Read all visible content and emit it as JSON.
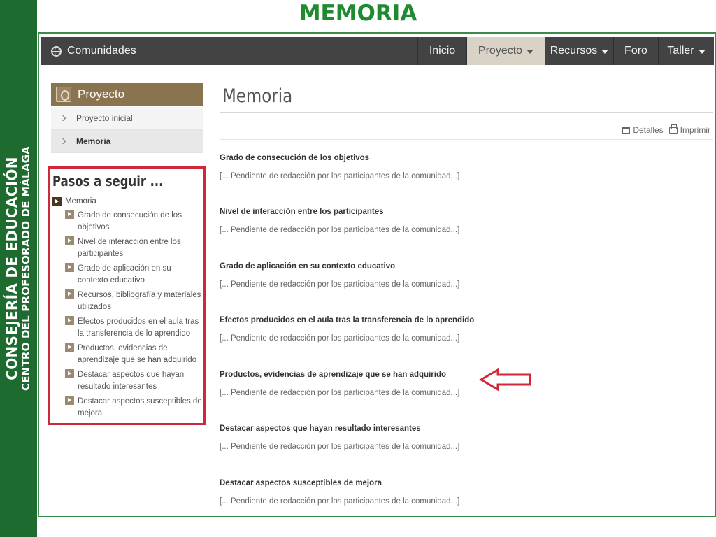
{
  "slide": {
    "title": "MEMORIA",
    "banner_line1": "CONSEJERÍA DE EDUCACIÓN",
    "banner_line2": "CENTRO DEL PROFESORADO DE MÁLAGA"
  },
  "topbar": {
    "brand": "Comunidades",
    "brand_icon": "globe-icon",
    "nav": [
      {
        "label": "Inicio",
        "dropdown": false,
        "active": false
      },
      {
        "label": "Proyecto",
        "dropdown": true,
        "active": true
      },
      {
        "label": "Recursos",
        "dropdown": true,
        "active": false
      },
      {
        "label": "Foro",
        "dropdown": false,
        "active": false
      },
      {
        "label": "Taller",
        "dropdown": true,
        "active": false
      }
    ]
  },
  "sidebar": {
    "header": "Proyecto",
    "items": [
      "Proyecto inicial",
      "Memoria"
    ],
    "steps_title": "Pasos a seguir ...",
    "steps_root": "Memoria",
    "steps": [
      "Grado de consecución de los objetivos",
      "Nivel de interacción entre los participantes",
      "Grado de aplicación en su contexto educativo",
      "Recursos, bibliografía y materiales utilizados",
      "Efectos producidos en el aula tras la transferencia de lo aprendido",
      "Productos, evidencias de aprendizaje que se han adquirido",
      "Destacar aspectos que hayan resultado interesantes",
      "Destacar aspectos susceptibles de mejora"
    ]
  },
  "main": {
    "heading": "Memoria",
    "actions": {
      "details": "Detalles",
      "print": "Imprimir"
    },
    "placeholder": "[... Pendiente de redacción por los participantes de la comunidad...]",
    "sections": [
      "Grado de consecución de los objetivos",
      "Nivel de interacción entre los participantes",
      "Grado de aplicación en su contexto educativo",
      "Efectos producidos en el aula tras la transferencia de lo aprendido",
      "Productos, evidencias de aprendizaje que se han adquirido",
      "Destacar aspectos que hayan resultado interesantes",
      "Destacar aspectos susceptibles de mejora"
    ],
    "highlighted_section": 4
  },
  "colors": {
    "banner_green": "#1d6b2e",
    "title_green": "#1f8a2f",
    "highlight_red": "#d0283a",
    "topbar": "#434343",
    "project_brown": "#8a7450"
  }
}
